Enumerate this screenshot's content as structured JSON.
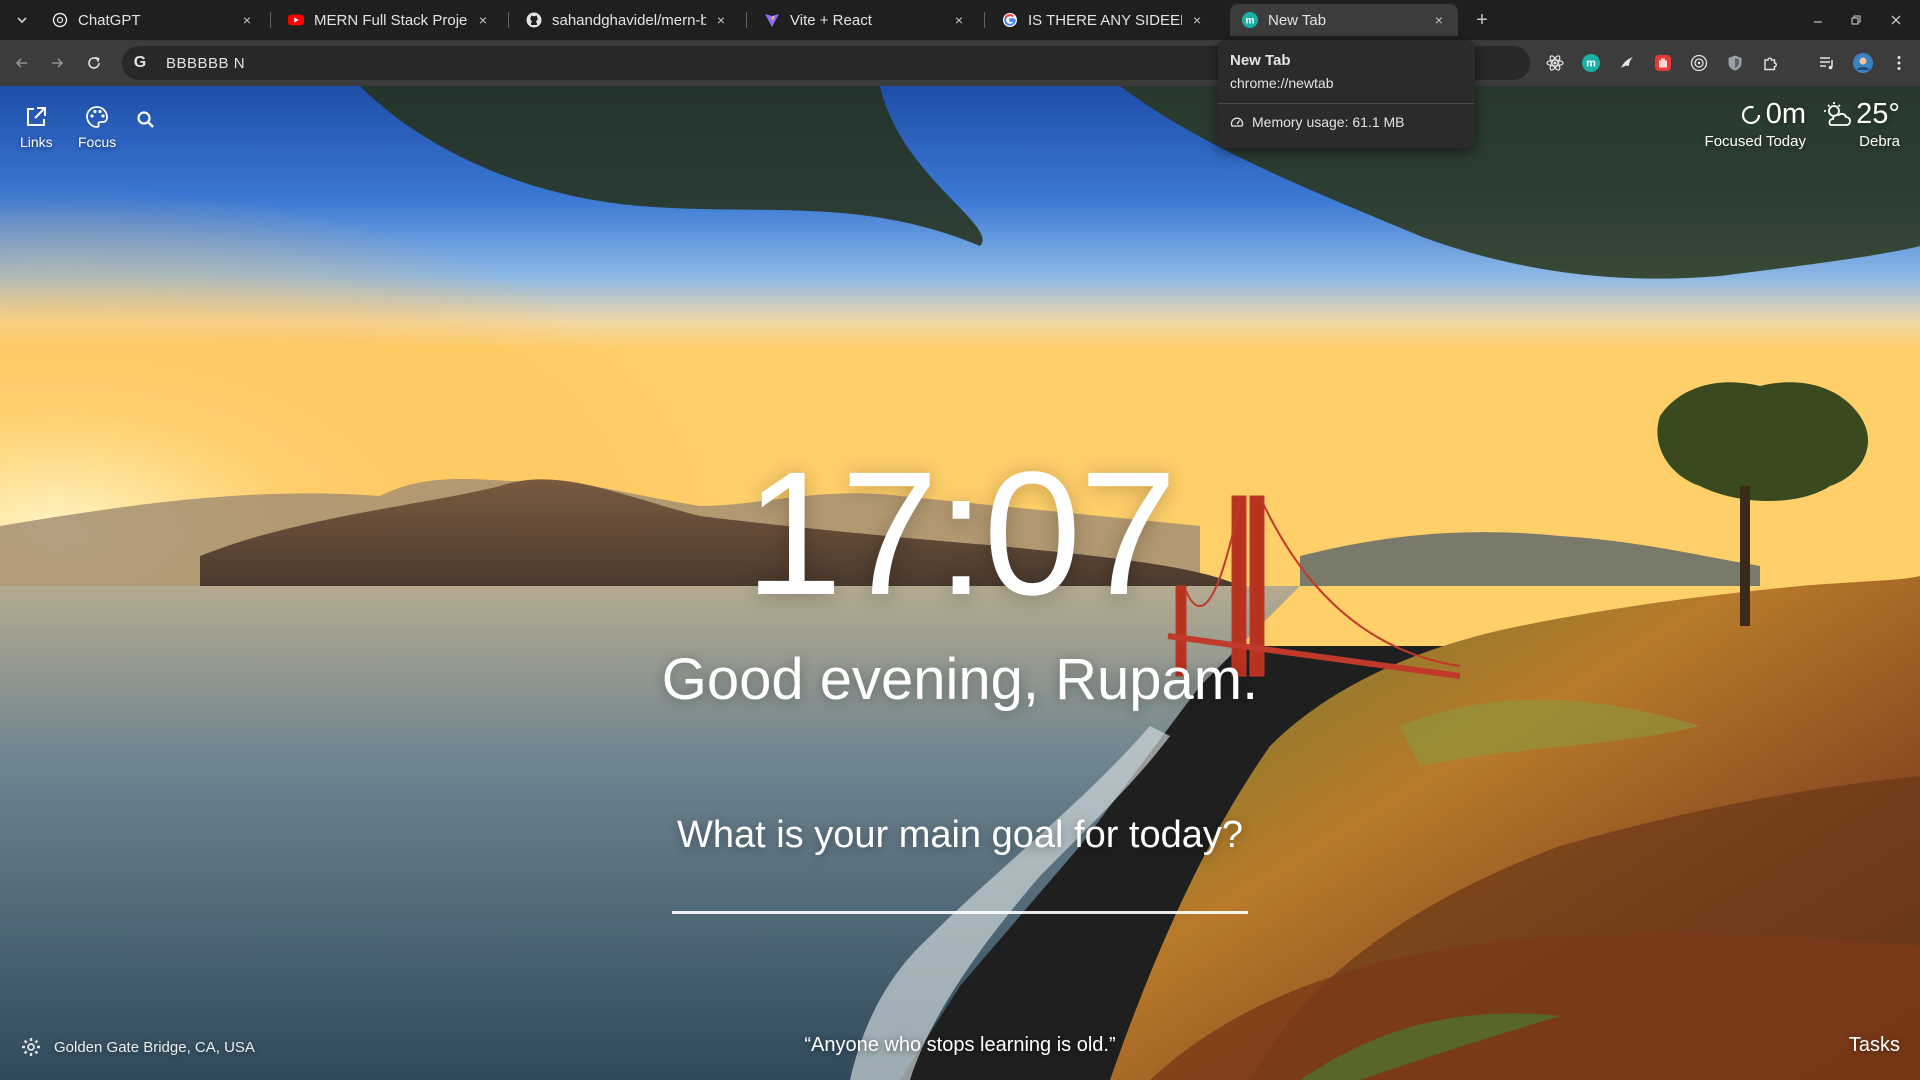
{
  "browser": {
    "tabs": [
      {
        "title": "ChatGPT",
        "icon": "chatgpt-icon",
        "active": false
      },
      {
        "title": "MERN Full Stack Project",
        "icon": "youtube-icon",
        "active": false
      },
      {
        "title": "sahandghavidel/mern-bl",
        "icon": "github-icon",
        "active": false
      },
      {
        "title": "Vite + React",
        "icon": "vite-icon",
        "active": false
      },
      {
        "title": "IS THERE ANY SIDEEFFEC",
        "icon": "google-icon",
        "active": false
      },
      {
        "title": "New Tab",
        "icon": "momentum-icon",
        "active": true
      }
    ],
    "close_glyph": "×",
    "new_tab_glyph": "+",
    "omnibox": {
      "text": "BBBBBB  N"
    },
    "tooltip": {
      "title": "New Tab",
      "url": "chrome://newtab",
      "memory": "Memory usage: 61.1 MB"
    }
  },
  "page": {
    "top_left": [
      {
        "label": "Links",
        "icon": "external-link-icon"
      },
      {
        "label": "Focus",
        "icon": "palette-icon"
      }
    ],
    "focus": {
      "value": "0m",
      "label": "Focused Today"
    },
    "weather": {
      "temp": "25°",
      "location": "Debra",
      "icon": "partly-cloudy-icon"
    },
    "clock": "17:07",
    "greeting": "Good evening, Rupam.",
    "goal_question": "What is your main goal for today?",
    "goal_value": "",
    "photo_location": "Golden Gate Bridge, CA, USA",
    "quote": "“Anyone who stops learning is old.”",
    "tasks_label": "Tasks"
  },
  "colors": {
    "chrome_dark": "#1f1f1f",
    "toolbar": "#3c3c3c",
    "active_tab": "#3c3c3c",
    "text": "#e3e3e3"
  }
}
